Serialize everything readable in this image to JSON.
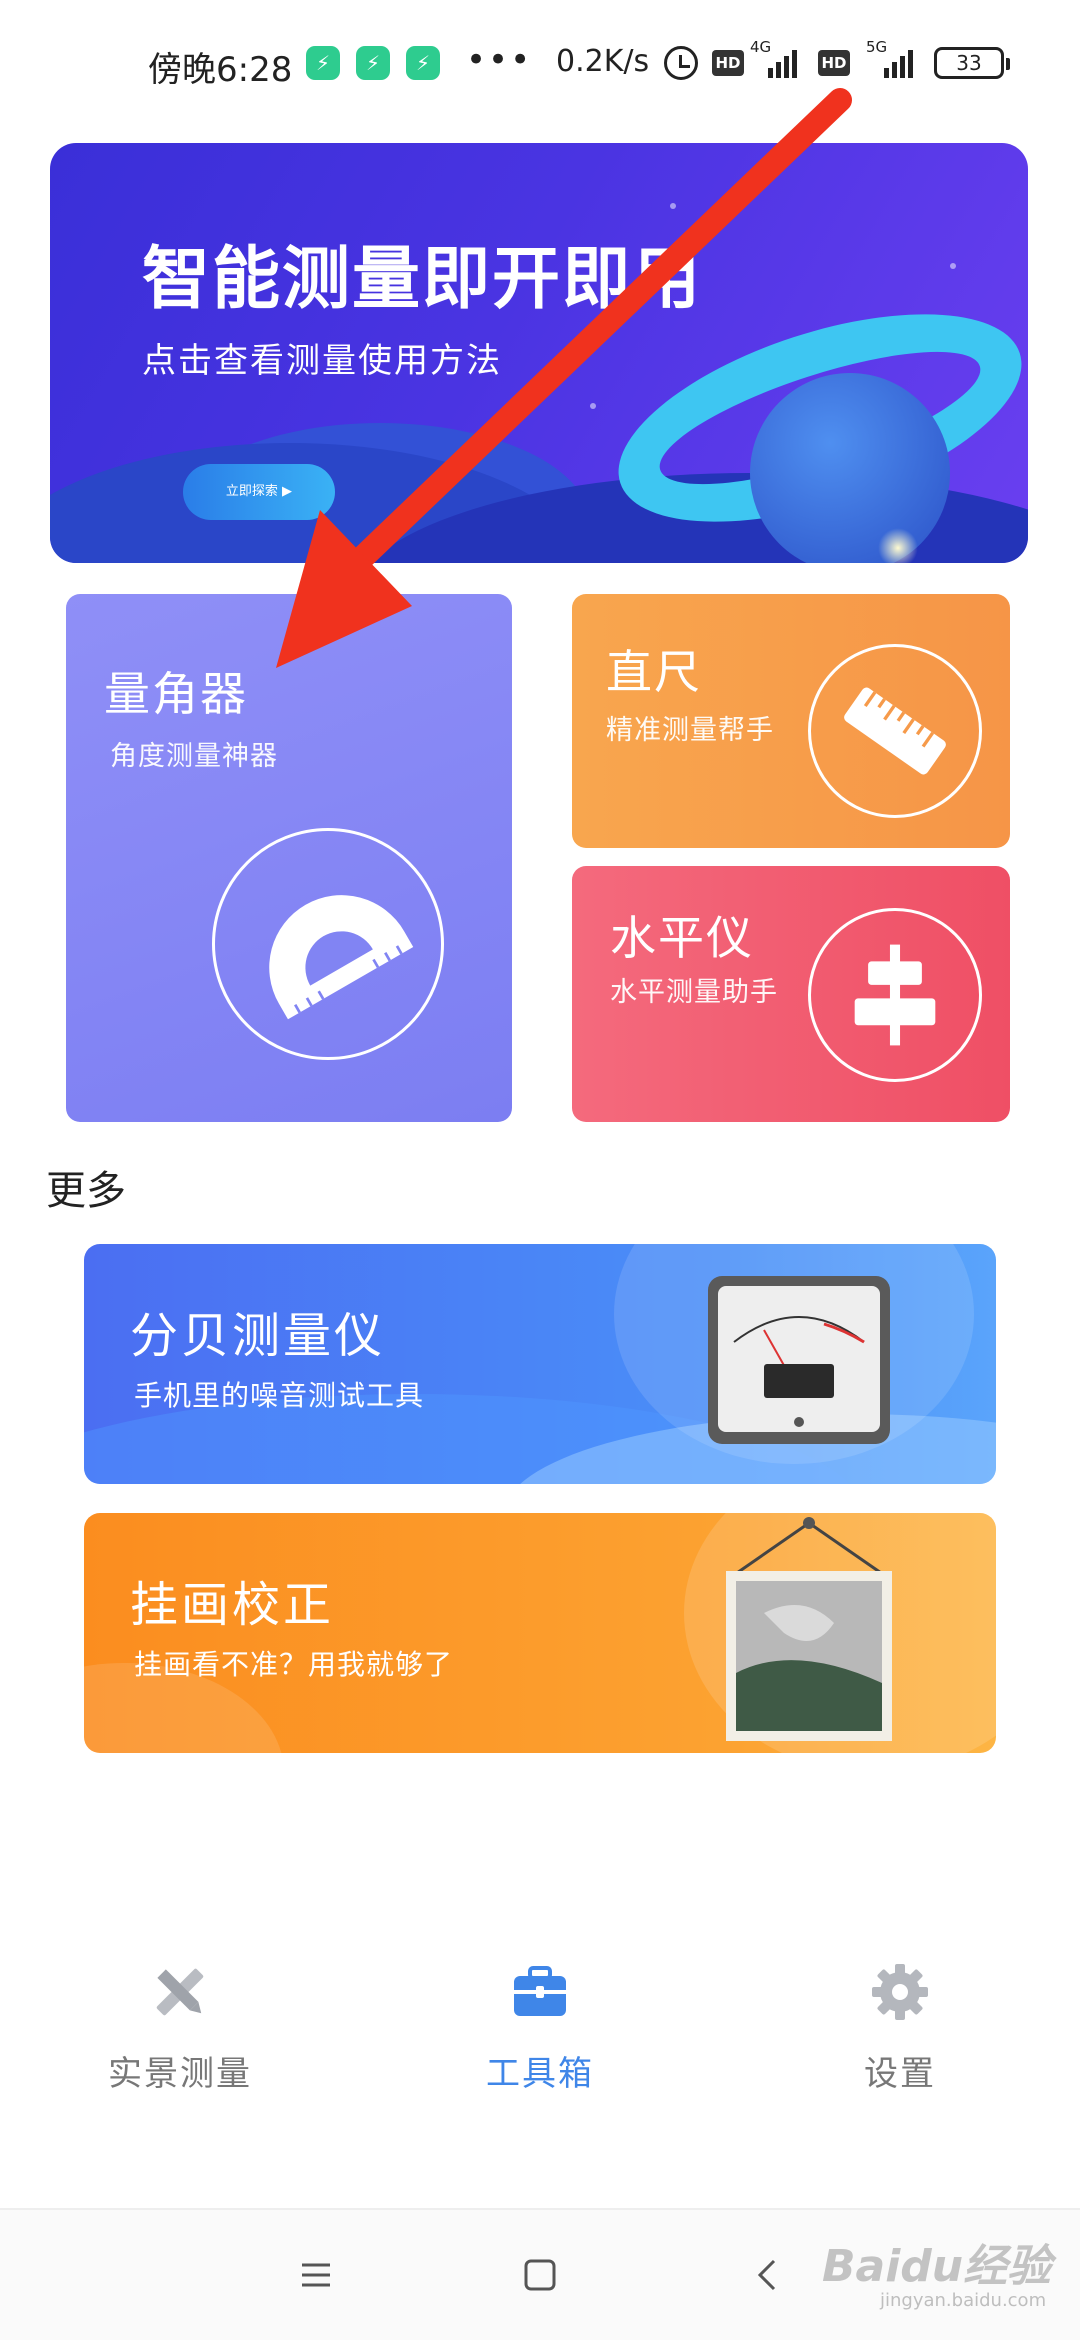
{
  "status_bar": {
    "time": "傍晚6:28",
    "more": "•••",
    "net_speed": "0.2K/s",
    "hd_1": "HD",
    "network_1": "4G",
    "hd_2": "HD",
    "network_2": "5G",
    "battery": "33"
  },
  "banner": {
    "title": "智能测量即开即用",
    "subtitle": "点击查看测量使用方法",
    "button": "立即探索 ▶"
  },
  "tools": {
    "protractor": {
      "title": "量角器",
      "subtitle": "角度测量神器",
      "icon": "protractor-icon"
    },
    "ruler": {
      "title": "直尺",
      "subtitle": "精准测量帮手",
      "icon": "ruler-icon"
    },
    "level": {
      "title": "水平仪",
      "subtitle": "水平测量助手",
      "icon": "level-icon"
    }
  },
  "more_section": {
    "title": "更多",
    "items": [
      {
        "title": "分贝测量仪",
        "subtitle": "手机里的噪音测试工具",
        "icon": "decibel-meter-icon"
      },
      {
        "title": "挂画校正",
        "subtitle": "挂画看不准？用我就够了",
        "icon": "hanging-picture-icon"
      }
    ]
  },
  "bottom_nav": {
    "items": [
      {
        "label": "实景测量",
        "icon": "ruler-pencil-icon",
        "active": false
      },
      {
        "label": "工具箱",
        "icon": "toolbox-icon",
        "active": true
      },
      {
        "label": "设置",
        "icon": "gear-icon",
        "active": false
      }
    ]
  },
  "watermark": {
    "text": "Baidu经验",
    "sub": "jingyan.baidu.com"
  },
  "colors": {
    "accent": "#3f86e8",
    "protractor_card": "#8486f4",
    "ruler_card": "#f79e4b",
    "level_card": "#f15d71",
    "decibel_card": "#4a7ff4",
    "painting_card": "#fc9a29",
    "annotation_arrow": "#f0321e"
  }
}
